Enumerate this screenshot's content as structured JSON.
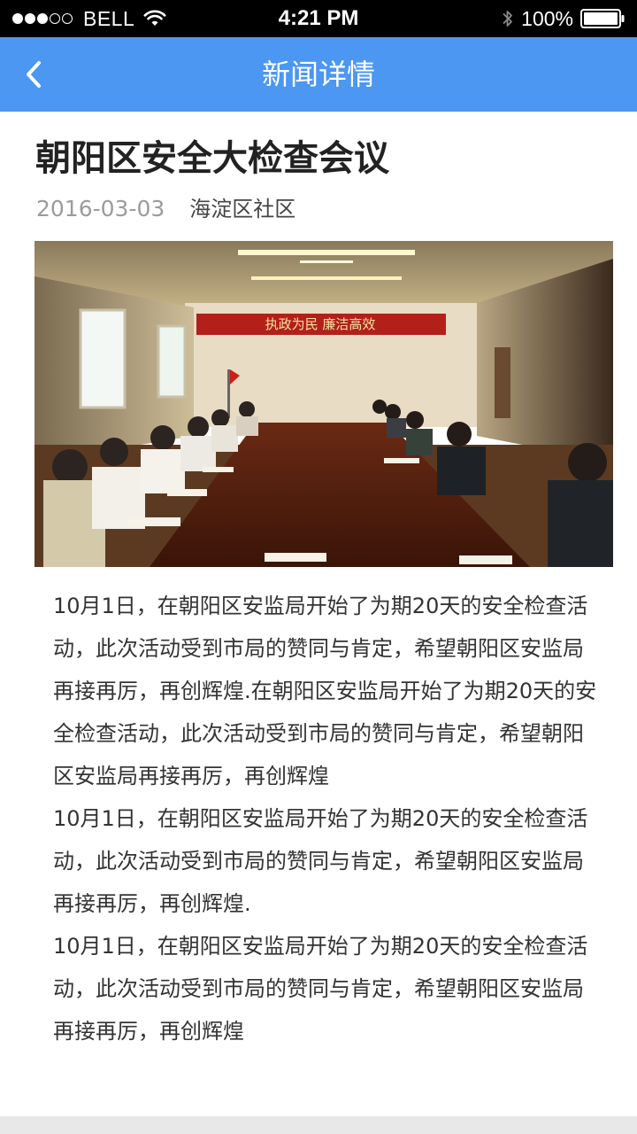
{
  "status_bar": {
    "carrier": "BELL",
    "time": "4:21 PM",
    "battery": "100%",
    "signal_bars_filled": 3,
    "signal_bars_total": 5,
    "icons": [
      "wifi-icon",
      "bluetooth-icon",
      "battery-icon"
    ]
  },
  "nav": {
    "back_icon": "chevron-left-icon",
    "title": "新闻详情",
    "bar_color": "#4b97f1"
  },
  "article": {
    "title": "朝阳区安全大检查会议",
    "date": "2016-03-03",
    "source": "海淀区社区",
    "banner_text": "执政为民 廉洁高效",
    "paragraphs": [
      "10月1日，在朝阳区安监局开始了为期20天的安全检查活动，此次活动受到市局的赞同与肯定，希望朝阳区安监局再接再厉，再创辉煌.在朝阳区安监局开始了为期20天的安全检查活动，此次活动受到市局的赞同与肯定，希望朝阳区安监局再接再厉，再创辉煌",
      "10月1日，在朝阳区安监局开始了为期20天的安全检查活动，此次活动受到市局的赞同与肯定，希望朝阳区安监局再接再厉，再创辉煌.",
      "10月1日，在朝阳区安监局开始了为期20天的安全检查活动，此次活动受到市局的赞同与肯定，希望朝阳区安监局再接再厉，再创辉煌"
    ]
  }
}
